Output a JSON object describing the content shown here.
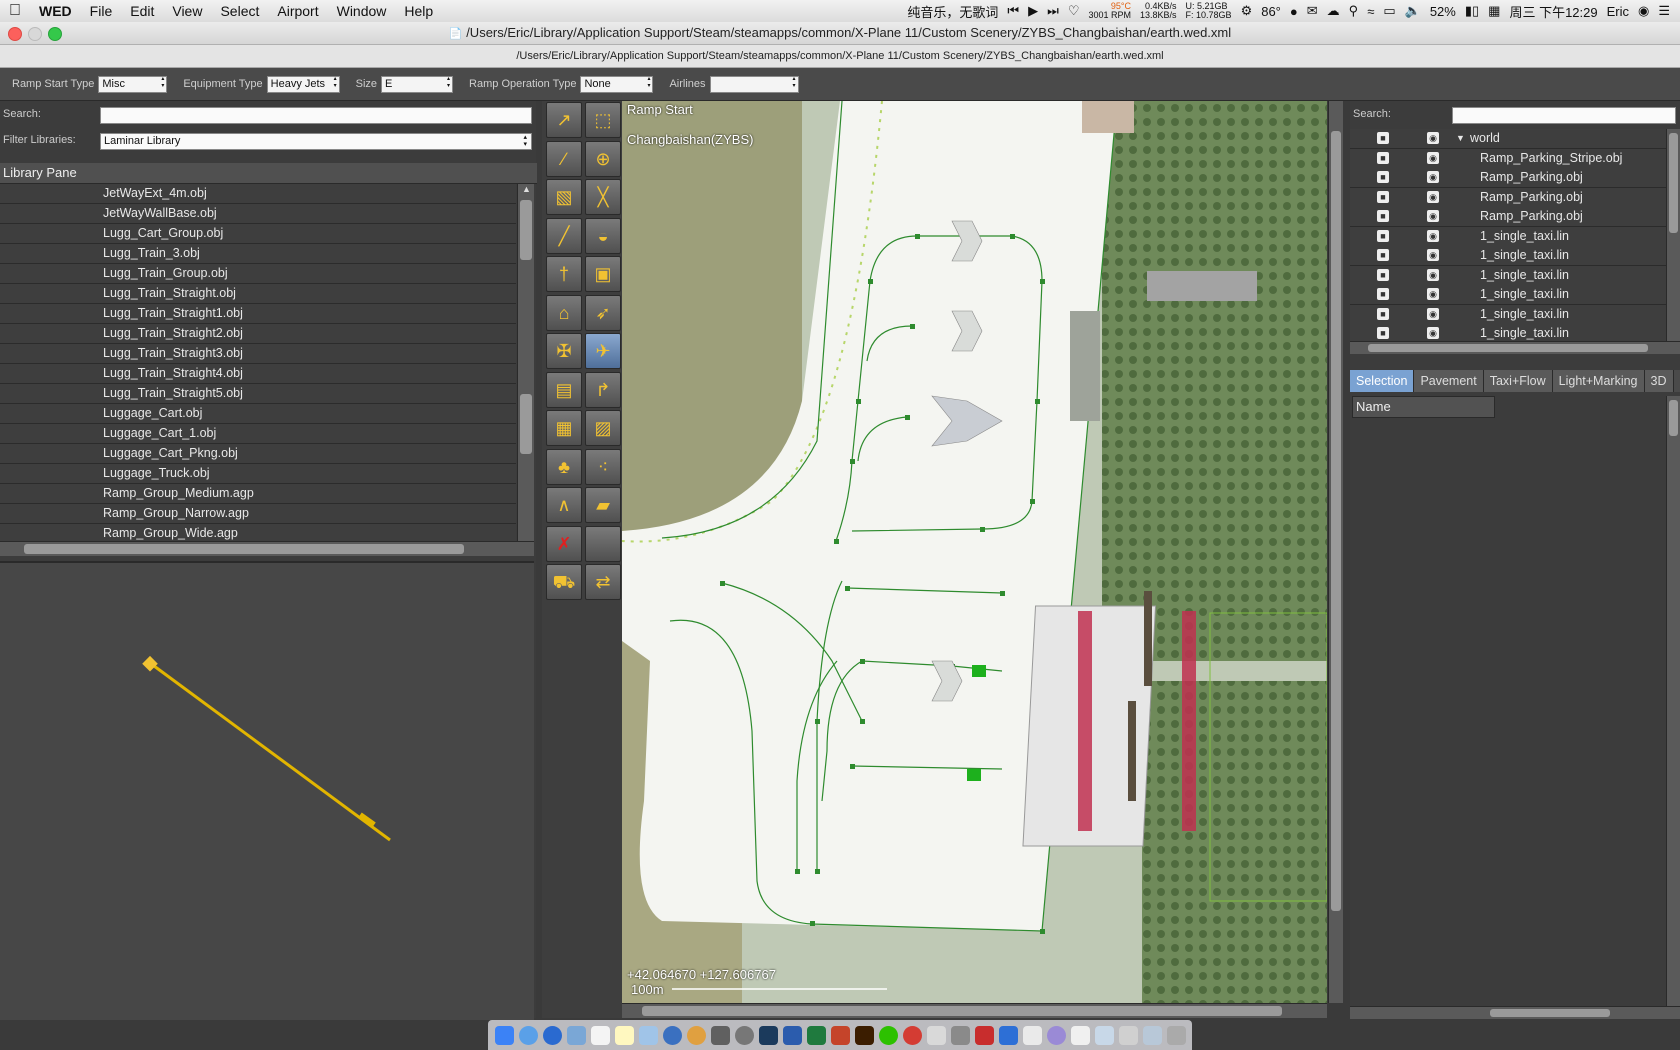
{
  "menubar": {
    "app_name": "WED",
    "items": [
      "File",
      "Edit",
      "View",
      "Select",
      "Airport",
      "Window",
      "Help"
    ],
    "song": "纯音乐，无歌词",
    "temp": "95°C",
    "rpm": "3001 RPM",
    "net_up": "0.4KB/s",
    "net_down": "13.8KB/s",
    "disk_u": "U:  5.21GB",
    "disk_f": "F: 10.78GB",
    "weather": "86°",
    "battery": "52%",
    "clock": "周三 下午12:29",
    "user": "Eric"
  },
  "window": {
    "title": "/Users/Eric/Library/Application Support/Steam/steamapps/common/X-Plane 11/Custom Scenery/ZYBS_Changbaishan/earth.wed.xml",
    "subtitle": "/Users/Eric/Library/Application Support/Steam/steamapps/common/X-Plane 11/Custom Scenery/ZYBS_Changbaishan/earth.wed.xml"
  },
  "propbar": {
    "ramp_start_type_label": "Ramp Start Type",
    "ramp_start_type_value": "Misc",
    "equipment_type_label": "Equipment Type",
    "equipment_type_value": "Heavy Jets",
    "size_label": "Size",
    "size_value": "E",
    "ramp_op_type_label": "Ramp Operation Type",
    "ramp_op_type_value": "None",
    "airlines_label": "Airlines",
    "airlines_value": ""
  },
  "library": {
    "search_label": "Search:",
    "search_value": "",
    "filter_label": "Filter Libraries:",
    "filter_value": "Laminar Library",
    "pane_title": "Library Pane",
    "items": [
      "JetWayExt_4m.obj",
      "JetWayWallBase.obj",
      "Lugg_Cart_Group.obj",
      "Lugg_Train_3.obj",
      "Lugg_Train_Group.obj",
      "Lugg_Train_Straight.obj",
      "Lugg_Train_Straight1.obj",
      "Lugg_Train_Straight2.obj",
      "Lugg_Train_Straight3.obj",
      "Lugg_Train_Straight4.obj",
      "Lugg_Train_Straight5.obj",
      "Luggage_Cart.obj",
      "Luggage_Cart_1.obj",
      "Luggage_Cart_Pkng.obj",
      "Luggage_Truck.obj",
      "Ramp_Group_Medium.agp",
      "Ramp_Group_Narrow.agp",
      "Ramp_Group_Wide.agp"
    ]
  },
  "map": {
    "tool_label": "Ramp Start",
    "airport_label": "Changbaishan(ZYBS)",
    "coords": "+42.064670 +127.606767",
    "scale_label": "100m"
  },
  "hierarchy": {
    "search_label": "Search:",
    "search_value": "",
    "root": "world",
    "items": [
      "Ramp_Parking_Stripe.obj",
      "Ramp_Parking.obj",
      "Ramp_Parking.obj",
      "Ramp_Parking.obj",
      "1_single_taxi.lin",
      "1_single_taxi.lin",
      "1_single_taxi.lin",
      "1_single_taxi.lin",
      "1_single_taxi.lin",
      "1_single_taxi.lin"
    ]
  },
  "tabs": [
    "Selection",
    "Pavement",
    "Taxi+Flow",
    "Light+Marking",
    "3D"
  ],
  "attributes": {
    "name_header": "Name"
  },
  "colors": {
    "accent": "#7aa2d2",
    "taxi_line": "#2e8b2e",
    "highlight": "#f1c232"
  }
}
